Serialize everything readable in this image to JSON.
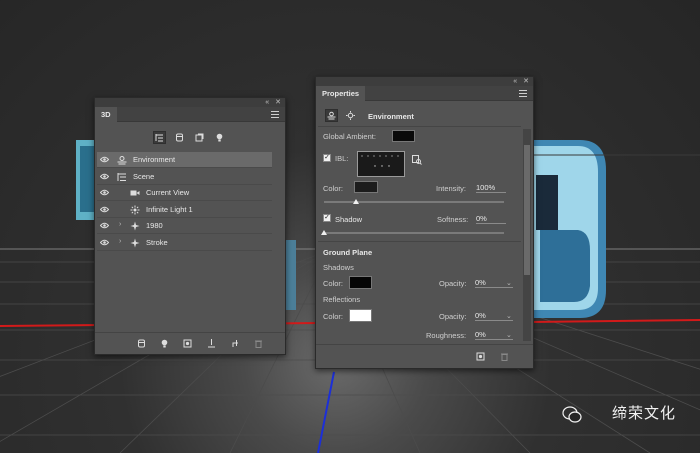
{
  "panel3d": {
    "title": "3D",
    "tool_icons": [
      "scene-filter-icon",
      "mesh-filter-icon",
      "material-filter-icon",
      "light-filter-icon"
    ],
    "rows": [
      {
        "label": "Environment",
        "icon": "environment-icon",
        "expandable": false,
        "selected": true,
        "indent": 1
      },
      {
        "label": "Scene",
        "icon": "scene-icon",
        "expandable": false,
        "selected": false,
        "indent": 1
      },
      {
        "label": "Current View",
        "icon": "camera-icon",
        "expandable": false,
        "selected": false,
        "indent": 2
      },
      {
        "label": "Infinite Light 1",
        "icon": "light-icon",
        "expandable": false,
        "selected": false,
        "indent": 2
      },
      {
        "label": "1980",
        "icon": "mesh-icon",
        "expandable": true,
        "selected": false,
        "indent": 2
      },
      {
        "label": "Stroke",
        "icon": "mesh-icon",
        "expandable": true,
        "selected": false,
        "indent": 2
      }
    ],
    "footer_icons": [
      "new-mesh-icon",
      "new-light-icon",
      "render-icon",
      "drop-to-plane-icon",
      "add-constraint-icon",
      "delete-icon"
    ]
  },
  "properties": {
    "title": "Properties",
    "section": "Environment",
    "global_ambient_label": "Global Ambient:",
    "ibl_label": "IBL:",
    "ibl_checked": true,
    "color_label": "Color:",
    "intensity_label": "Intensity:",
    "intensity_value": "100%",
    "intensity_level": 1.0,
    "shadow_label": "Shadow",
    "shadow_checked": true,
    "softness_label": "Softness:",
    "softness_value": "0%",
    "softness_level": 0.0,
    "ground_plane_label": "Ground Plane",
    "shadows_label": "Shadows",
    "shadows_color_label": "Color:",
    "shadows_opacity_label": "Opacity:",
    "shadows_opacity_value": "0%",
    "reflections_label": "Reflections",
    "reflections_color_label": "Color:",
    "reflections_opacity_label": "Opacity:",
    "reflections_opacity_value": "0%",
    "roughness_label": "Roughness:",
    "roughness_value": "0%"
  },
  "window_controls": {
    "collapse": "«",
    "close": "✕"
  },
  "colors": {
    "panel_bg": "#535353",
    "ambient_swatch": "#0a0a0a",
    "ibl_color_swatch": "#1c1c1c",
    "shadow_color_swatch": "#050505",
    "reflection_color_swatch": "#ffffff",
    "accent_red": "#d21a1a",
    "accent_blue": "#1c2fd8"
  },
  "watermark": "缔荣文化"
}
